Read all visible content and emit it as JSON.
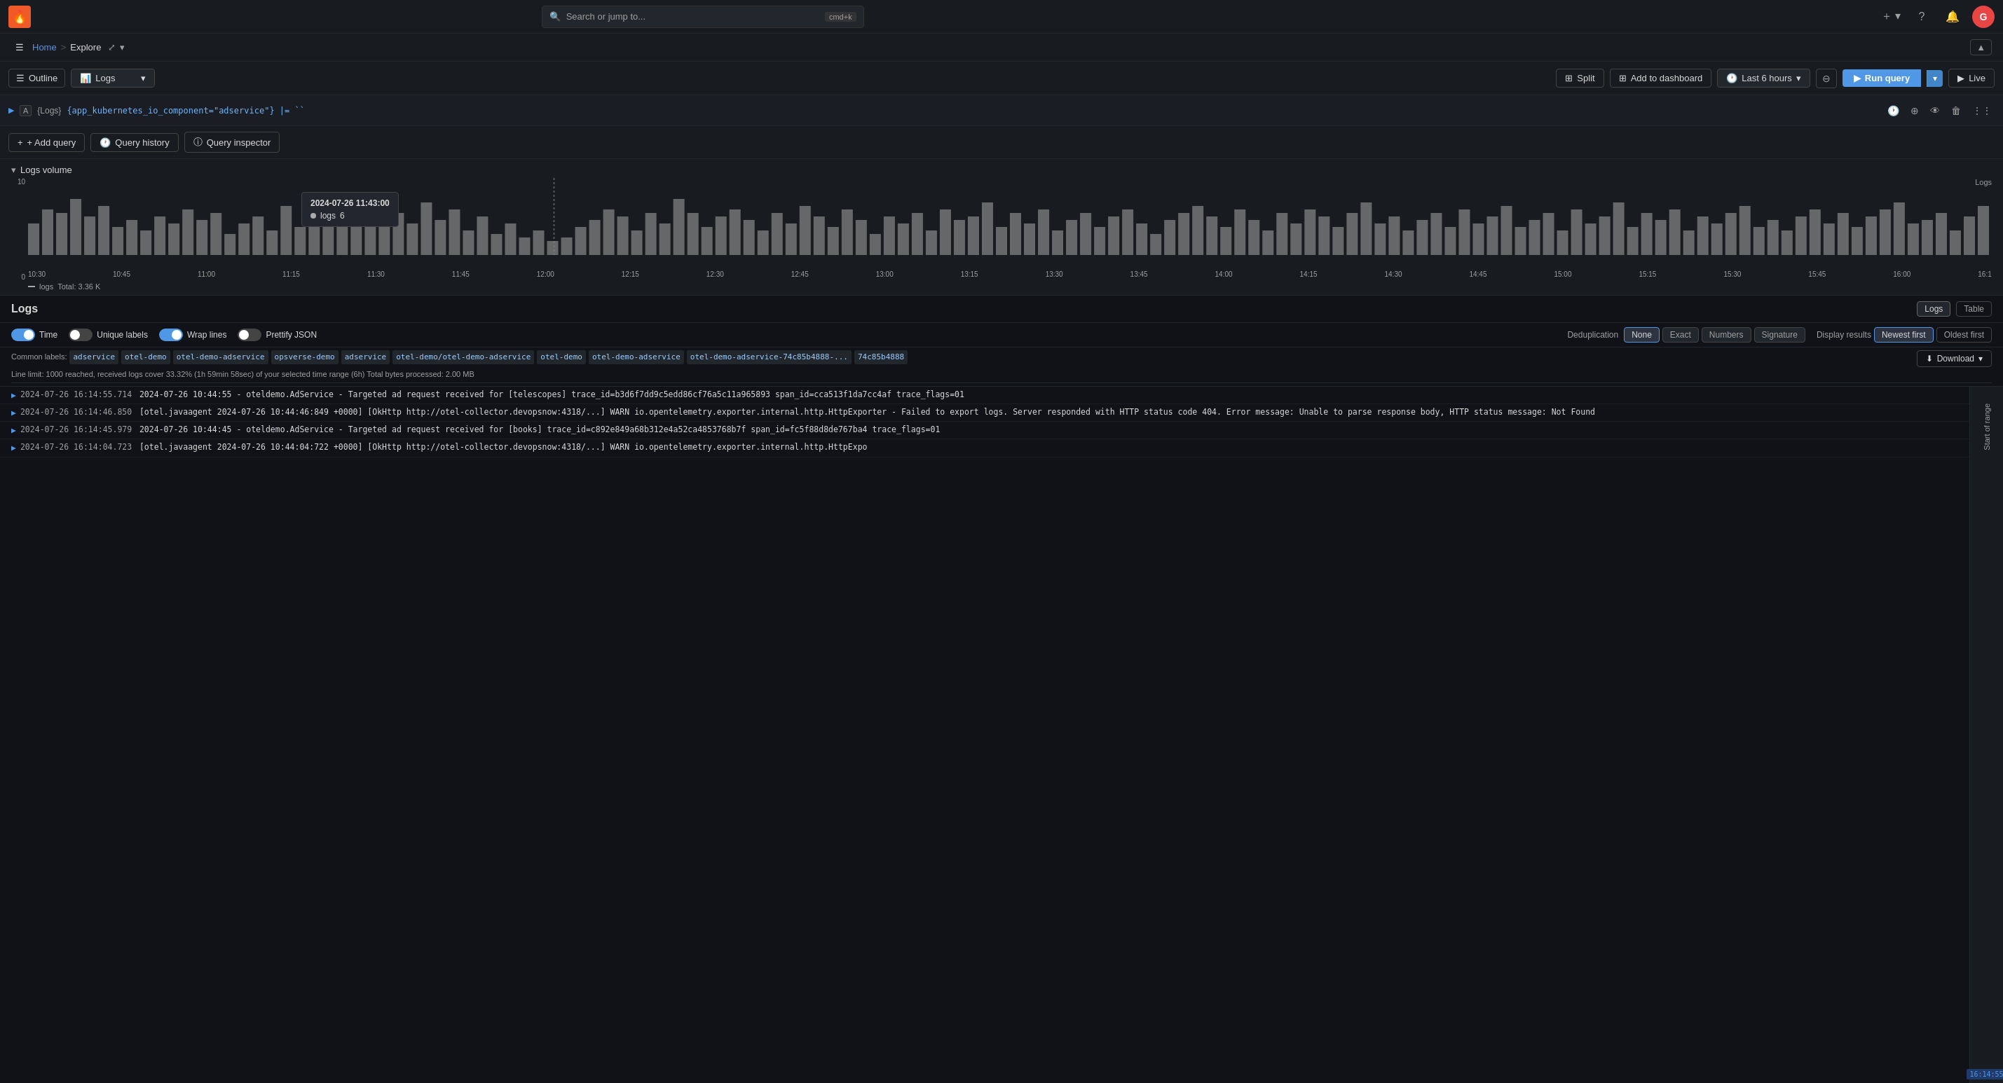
{
  "topnav": {
    "logo": "🔥",
    "search_placeholder": "Search or jump to...",
    "search_shortcut": "cmd+k",
    "plus_label": "+",
    "help_label": "?",
    "bell_label": "🔔"
  },
  "breadcrumb": {
    "home": "Home",
    "separator": ">",
    "current": "Explore",
    "share_icon": "share",
    "collapse_icon": "^"
  },
  "toolbar": {
    "outline_label": "Outline",
    "datasource_label": "Logs",
    "split_label": "Split",
    "add_dashboard_label": "Add to dashboard",
    "time_label": "Last 6 hours",
    "run_query_label": "Run query",
    "live_label": "Live"
  },
  "query_row": {
    "expand_icon": ">",
    "label": "A",
    "datasource_tag": "{Logs}",
    "expression": "{app_kubernetes_io_component=\"adservice\"} |= ``",
    "action_icons": [
      "clock",
      "copy",
      "eye",
      "trash",
      "dots"
    ]
  },
  "query_actions": {
    "add_query_label": "+ Add query",
    "query_history_label": "Query history",
    "query_inspector_label": "Query inspector"
  },
  "logs_volume": {
    "title": "Logs volume",
    "legend_label": "logs",
    "legend_total": "Total: 3.36 K",
    "chart_label": "Logs",
    "x_axis": [
      "10:30",
      "10:45",
      "11:00",
      "11:15",
      "11:30",
      "11:45",
      "12:00",
      "12:15",
      "12:30",
      "12:45",
      "13:00",
      "13:15",
      "13:30",
      "13:45",
      "14:00",
      "14:15",
      "14:30",
      "14:45",
      "15:00",
      "15:15",
      "15:30",
      "15:45",
      "16:00",
      "16:1"
    ],
    "y_axis": [
      "10",
      "0"
    ],
    "tooltip": {
      "time": "2024-07-26 11:43:00",
      "series": "logs",
      "value": "6"
    }
  },
  "logs_panel": {
    "title": "Logs",
    "view_logs_label": "Logs",
    "view_table_label": "Table",
    "time_toggle_label": "Time",
    "time_toggle_on": true,
    "unique_labels_toggle_label": "Unique labels",
    "unique_labels_toggle_on": false,
    "wrap_lines_toggle_label": "Wrap lines",
    "wrap_lines_toggle_on": true,
    "prettify_json_toggle_label": "Prettify JSON",
    "prettify_json_toggle_on": false,
    "deduplication_label": "Deduplication",
    "dedup_none": "None",
    "dedup_exact": "Exact",
    "dedup_numbers": "Numbers",
    "dedup_signature": "Signature",
    "display_results_label": "Display results",
    "newest_first_label": "Newest first",
    "oldest_first_label": "Oldest first",
    "download_label": "Download"
  },
  "common_labels": {
    "prefix": "Common labels:",
    "tags": [
      "adservice",
      "otel-demo",
      "otel-demo-adservice",
      "opsverse-demo",
      "adservice",
      "otel-demo/otel-demo-adservice",
      "otel-demo",
      "otel-demo-adservice",
      "otel-demo-adservice-74c85b4888-...",
      "74c85b4888"
    ],
    "line_limit": "Line limit: 1000 reached, received logs cover 33.32% (1h 59min 58sec) of your selected time range (6h)   Total bytes processed: 2.00 MB"
  },
  "log_entries": [
    {
      "time": "2024-07-26 16:14:55.714",
      "message": "2024-07-26 10:44:55 - oteldemo.AdService - Targeted ad request received for [telescopes] trace_id=b3d6f7dd9c5edd86cf76a5c11a965893 span_id=cca513f1da7cc4af trace_flags=01"
    },
    {
      "time": "2024-07-26 16:14:46.850",
      "message": "[otel.javaagent 2024-07-26 10:44:46:849 +0000] [OkHttp http://otel-collector.devopsnow:4318/...] WARN io.opentelemetry.exporter.internal.http.HttpExporter - Failed to export logs. Server responded with HTTP status code 404. Error message: Unable to parse response body, HTTP status message: Not Found"
    },
    {
      "time": "2024-07-26 16:14:45.979",
      "message": "2024-07-26 10:44:45 - oteldemo.AdService - Targeted ad request received for [books] trace_id=c892e849a68b312e4a52ca4853768b7f span_id=fc5f88d8de767ba4 trace_flags=01"
    },
    {
      "time": "2024-07-26 16:14:04.723",
      "message": "[otel.javaagent 2024-07-26 10:44:04:722 +0000] [OkHttp http://otel-collector.devopsnow:4318/...] WARN io.opentelemetry.exporter.internal.http.HttpExpo"
    }
  ],
  "right_sidebar": {
    "start_of_range_label": "Start of range",
    "time_indicator": "16:14:55"
  }
}
